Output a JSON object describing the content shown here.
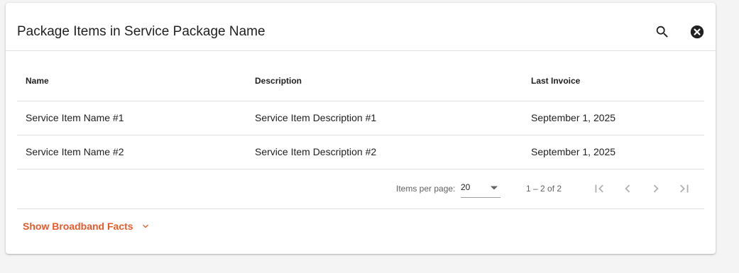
{
  "dialog": {
    "title": "Package Items in Service Package Name",
    "search_icon": "search-icon",
    "close_icon": "close-circle-icon"
  },
  "table": {
    "columns": [
      "Name",
      "Description",
      "Last Invoice"
    ],
    "rows": [
      [
        "Service Item Name #1",
        "Service Item Description #1",
        "September 1, 2025"
      ],
      [
        "Service Item Name #2",
        "Service Item Description #2",
        "September 1, 2025"
      ]
    ]
  },
  "paginator": {
    "items_per_page_label": "Items per page:",
    "items_per_page_value": "20",
    "range_label": "1 – 2 of 2",
    "buttons": [
      "first-page-icon",
      "chevron-left-icon",
      "chevron-right-icon",
      "last-page-icon"
    ]
  },
  "broadband": {
    "label": "Show Broadband Facts",
    "icon": "chevron-down-icon"
  },
  "colors": {
    "accent": "#e65a2b",
    "background": "#f4f4f4",
    "card": "#ffffff",
    "divider": "#e0e0e0",
    "pager_icon_disabled": "#b0b0b0"
  }
}
